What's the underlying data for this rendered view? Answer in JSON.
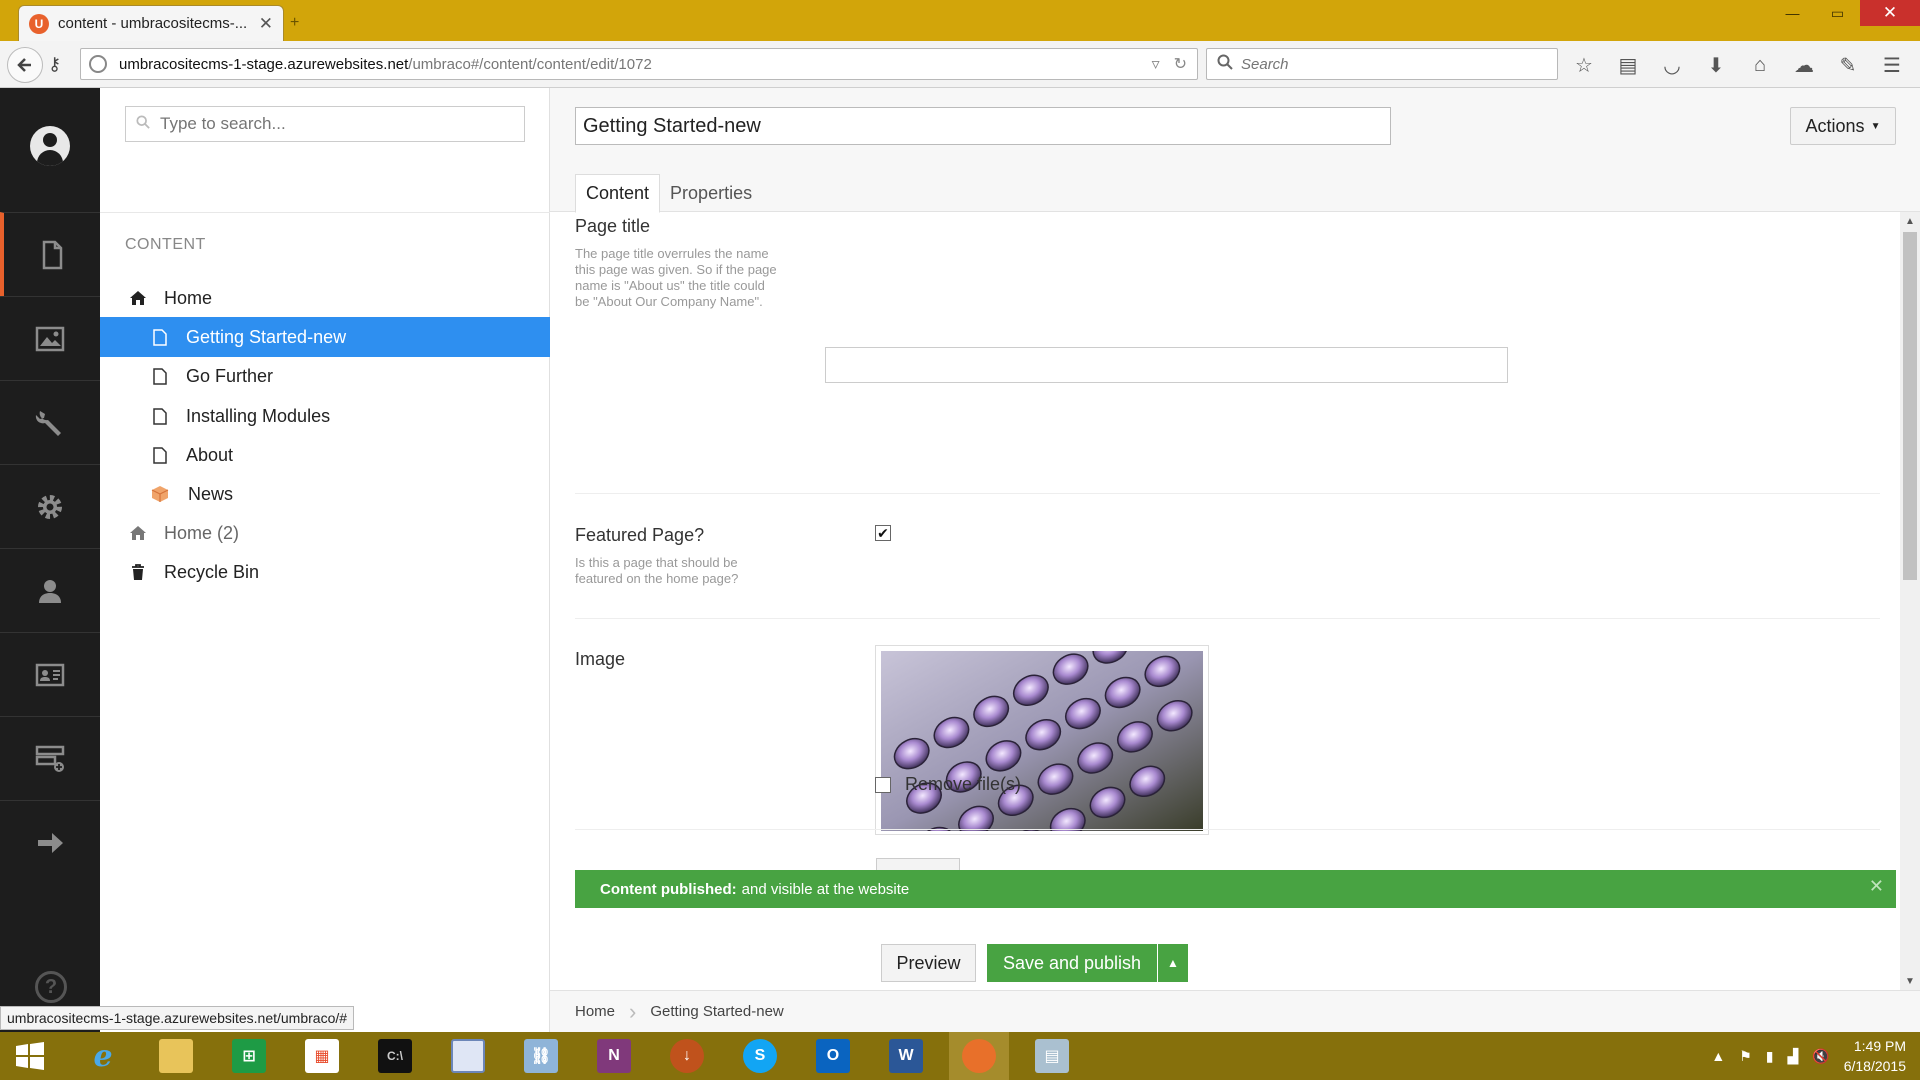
{
  "browser": {
    "tab_title": "content - umbracositecms-...",
    "tab_close": "✕",
    "new_tab": "+",
    "window_buttons": {
      "minimize": "—",
      "maximize": "▭",
      "close": "✕"
    },
    "url_domain": "umbracositecms-1-stage.azurewebsites.net",
    "url_path": "/umbraco#/content/content/edit/1072",
    "search_placeholder": "Search",
    "status_url": "umbracositecms-1-stage.azurewebsites.net/umbraco/#"
  },
  "tree": {
    "search_placeholder": "Type to search...",
    "section_title": "CONTENT",
    "items": [
      {
        "label": "Home",
        "icon": "home-icon"
      },
      {
        "label": "Getting Started-new",
        "icon": "document-icon"
      },
      {
        "label": "Go Further",
        "icon": "document-icon"
      },
      {
        "label": "Installing Modules",
        "icon": "document-icon"
      },
      {
        "label": "About",
        "icon": "document-icon"
      },
      {
        "label": "News",
        "icon": "box-icon"
      },
      {
        "label": "Home (2)",
        "icon": "home-icon"
      },
      {
        "label": "Recycle Bin",
        "icon": "trash-icon"
      }
    ]
  },
  "editor": {
    "node_name": "Getting Started-new",
    "actions_label": "Actions",
    "tabs": [
      {
        "label": "Content"
      },
      {
        "label": "Properties"
      }
    ],
    "fields": {
      "page_title": {
        "label": "Page title",
        "description": "The page title overrules the name this page was given. So if the page name is \"About us\" the title could be \"About Our Company Name\".",
        "value": ""
      },
      "featured": {
        "label": "Featured Page?",
        "description": "Is this a page that should be featured on the home page?",
        "checked": true
      },
      "image": {
        "label": "Image",
        "remove_label": "Remove file(s)"
      }
    },
    "notification": {
      "title": "Content published:",
      "message": "and visible at the website",
      "close": "✕"
    },
    "buttons": {
      "preview": "Preview",
      "save_publish": "Save and publish"
    },
    "breadcrumb": [
      "Home",
      "Getting Started-new"
    ]
  },
  "taskbar": {
    "time": "1:49 PM",
    "date": "6/18/2015"
  },
  "colors": {
    "accent": "#e8612c",
    "selected": "#2e8ff0",
    "success": "#48a342",
    "browser_titlebar": "#d2a50a",
    "sidebar": "#1d1d1d"
  }
}
